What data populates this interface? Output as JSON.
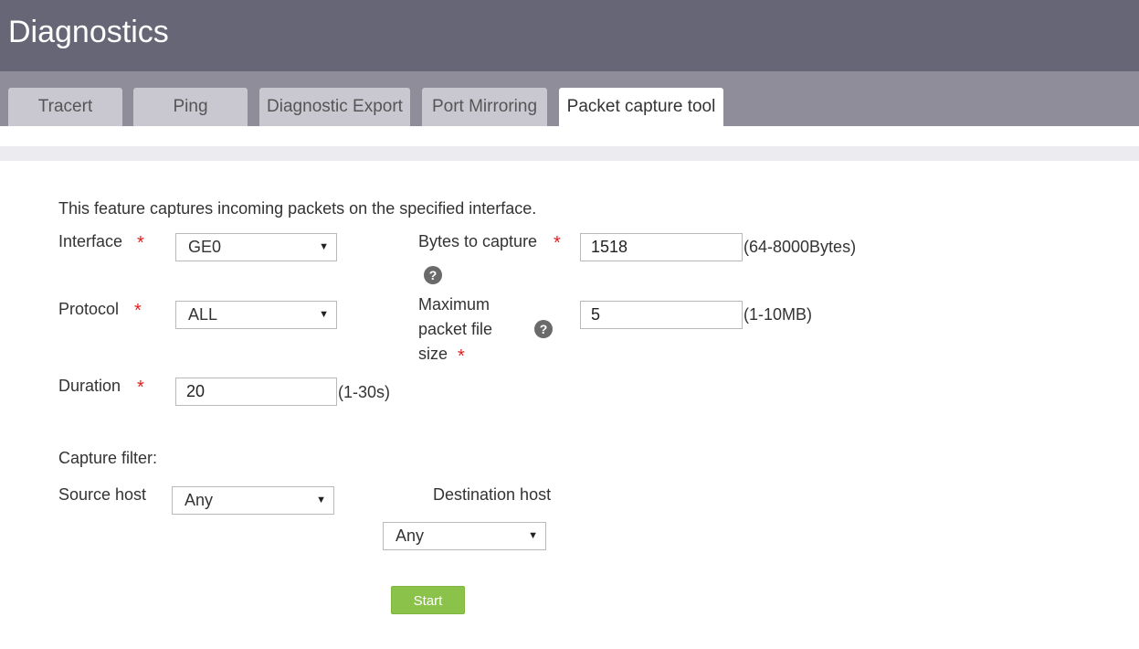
{
  "header": {
    "title": "Diagnostics"
  },
  "tabs": [
    {
      "label": "Tracert"
    },
    {
      "label": "Ping"
    },
    {
      "label": "Diagnostic Export"
    },
    {
      "label": "Port Mirroring"
    },
    {
      "label": "Packet capture tool",
      "active": true
    }
  ],
  "form": {
    "description": "This feature captures incoming packets on the specified interface.",
    "required_marker": "*",
    "interface": {
      "label": "Interface",
      "value": "GE0"
    },
    "protocol": {
      "label": "Protocol",
      "value": "ALL"
    },
    "duration": {
      "label": "Duration",
      "value": "20",
      "range": "(1-30s)"
    },
    "bytes_to_capture": {
      "label": "Bytes to capture",
      "value": "1518",
      "range": "(64-8000Bytes)"
    },
    "max_file_size": {
      "label_line1": "Maximum",
      "label_line2": "packet file",
      "label_line3": "size",
      "value": "5",
      "range": "(1-10MB)"
    },
    "capture_filter": {
      "label": "Capture filter:"
    },
    "source_host": {
      "label": "Source host",
      "value": "Any"
    },
    "destination_host": {
      "label": "Destination host",
      "value": "Any"
    },
    "start_label": "Start",
    "help_glyph": "?",
    "caret_glyph": "▼"
  }
}
